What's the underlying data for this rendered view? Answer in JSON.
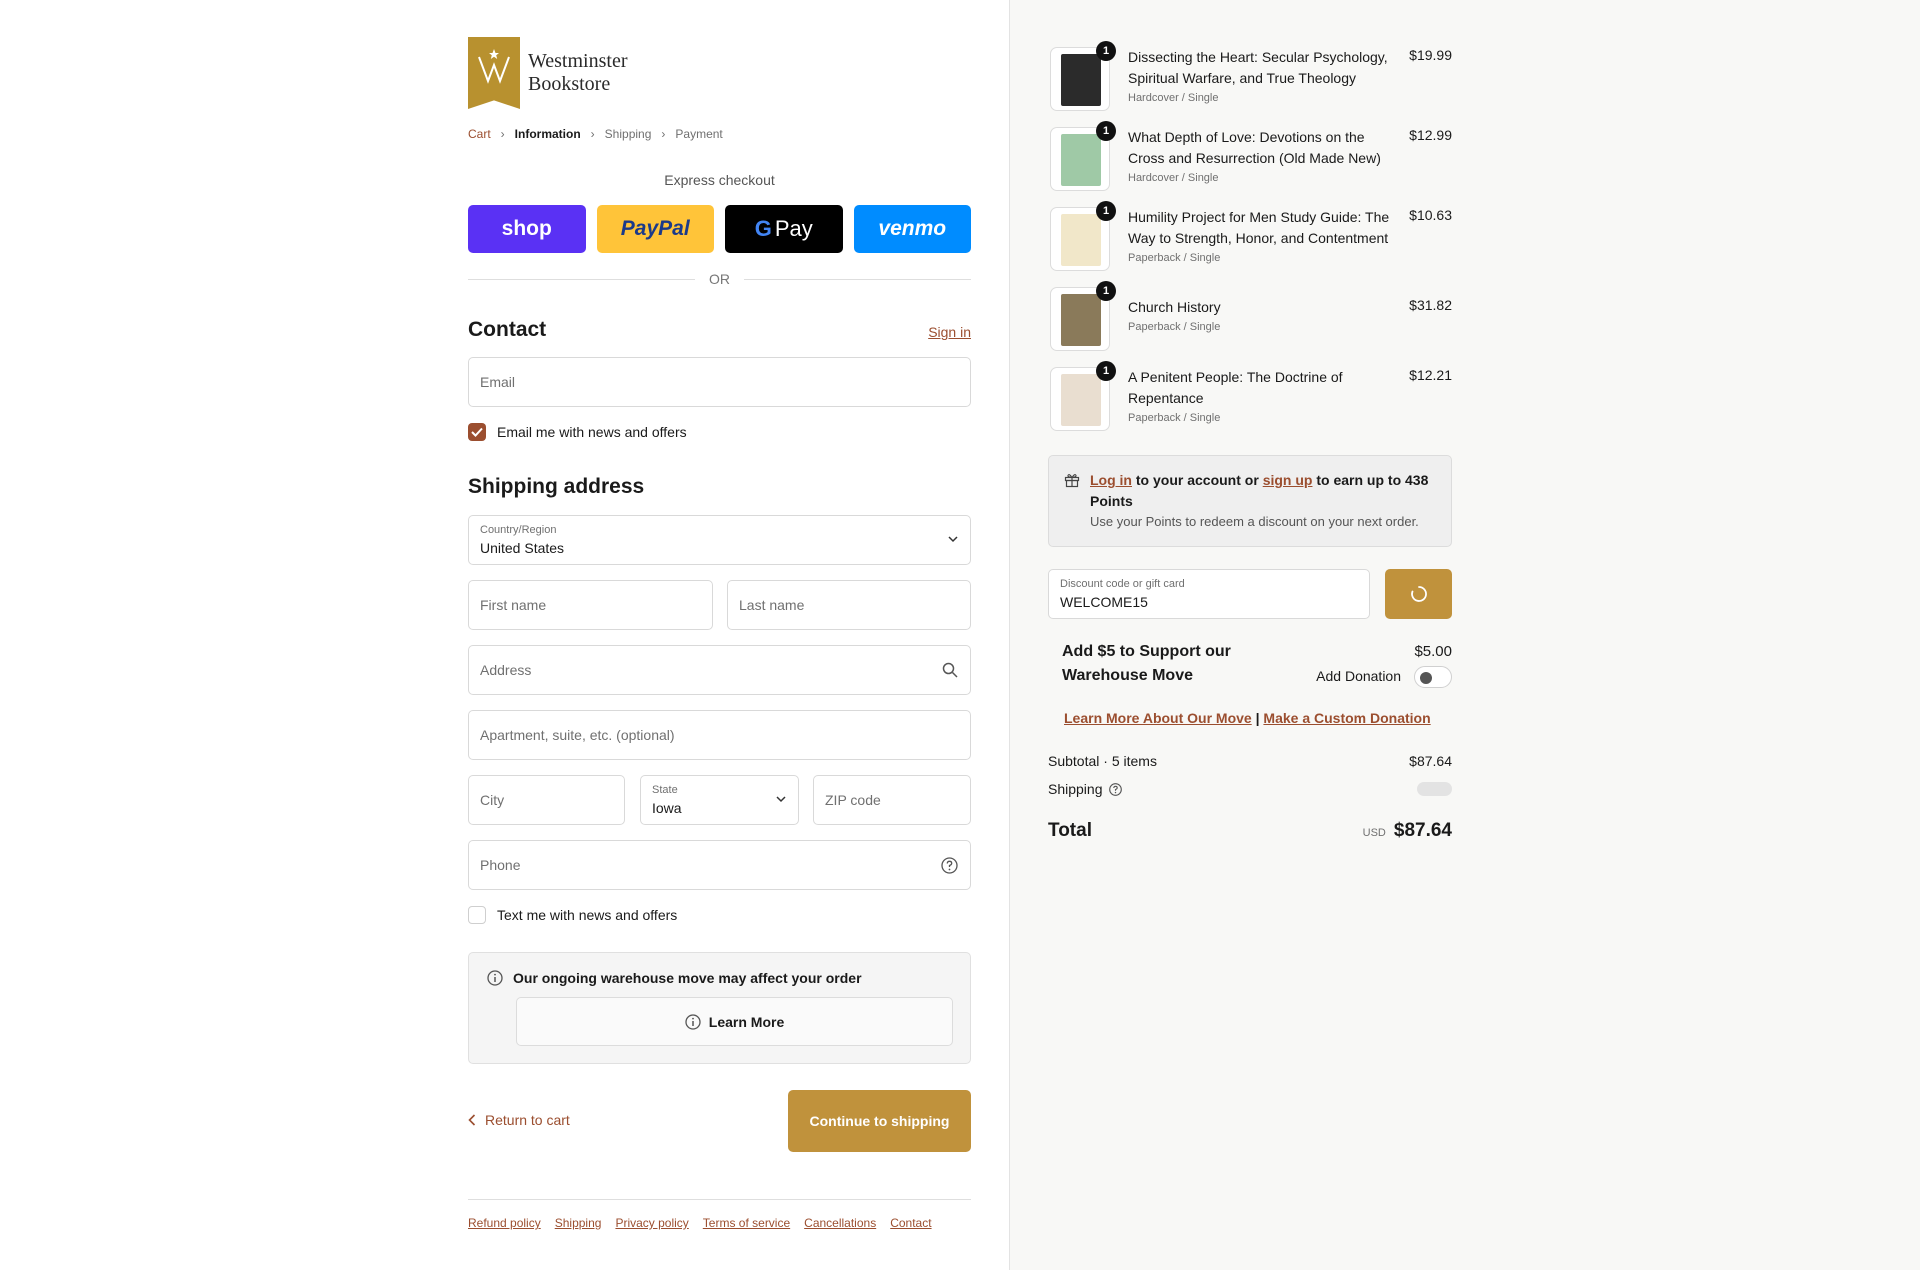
{
  "store": {
    "name_line1": "Westminster",
    "name_line2": "Bookstore",
    "brand_color": "#b8912f",
    "accent_color": "#9b4e2f"
  },
  "breadcrumb": [
    {
      "label": "Cart",
      "state": "link"
    },
    {
      "label": "Information",
      "state": "current"
    },
    {
      "label": "Shipping",
      "state": "upcoming"
    },
    {
      "label": "Payment",
      "state": "upcoming"
    }
  ],
  "express": {
    "title": "Express checkout",
    "shop": "shop",
    "paypal": "PayPal",
    "gpay": "Pay",
    "venmo": "venmo",
    "or": "OR"
  },
  "contact": {
    "heading": "Contact",
    "sign_in": "Sign in",
    "email_placeholder": "Email",
    "email_news": "Email me with news and offers",
    "email_news_checked": true
  },
  "shipping": {
    "heading": "Shipping address",
    "country_label": "Country/Region",
    "country_value": "United States",
    "first_name": "First name",
    "last_name": "Last name",
    "address": "Address",
    "apartment": "Apartment, suite, etc. (optional)",
    "city": "City",
    "state_label": "State",
    "state_value": "Iowa",
    "zip": "ZIP code",
    "phone": "Phone",
    "text_news": "Text me with news and offers",
    "text_news_checked": false
  },
  "notice": {
    "title": "Our ongoing warehouse move may affect your order",
    "button": "Learn More"
  },
  "actions": {
    "return": "Return to cart",
    "continue": "Continue to shipping"
  },
  "footer": [
    "Refund policy",
    "Shipping",
    "Privacy policy",
    "Terms of service",
    "Cancellations",
    "Contact"
  ],
  "items": [
    {
      "title": "Dissecting the Heart: Secular Psychology, Spiritual Warfare, and True Theology",
      "variant": "Hardcover / Single",
      "price": "$19.99",
      "qty": "1",
      "cover_color": "#2b2b2b"
    },
    {
      "title": "What Depth of Love: Devotions on the Cross and Resurrection (Old Made New)",
      "variant": "Hardcover / Single",
      "price": "$12.99",
      "qty": "1",
      "cover_color": "#9fc9a6"
    },
    {
      "title": "Humility Project for Men Study Guide: The Way to Strength, Honor, and Contentment",
      "variant": "Paperback / Single",
      "price": "$10.63",
      "qty": "1",
      "cover_color": "#f1e7c9"
    },
    {
      "title": "Church History",
      "variant": "Paperback / Single",
      "price": "$31.82",
      "qty": "1",
      "cover_color": "#8a7a5a"
    },
    {
      "title": "A Penitent People: The Doctrine of Repentance",
      "variant": "Paperback / Single",
      "price": "$12.21",
      "qty": "1",
      "cover_color": "#e9ded0"
    }
  ],
  "points": {
    "login": "Log in",
    "mid": " to your account or ",
    "signup": "sign up",
    "end": " to earn up to 438 Points",
    "sub": "Use your Points to redeem a discount on your next order."
  },
  "discount": {
    "label": "Discount code or gift card",
    "value": "WELCOME15"
  },
  "donation": {
    "title": "Add $5 to Support our Warehouse Move",
    "price": "$5.00",
    "toggle_label": "Add Donation",
    "enabled": false,
    "link1": "Learn More About Our Move",
    "sep": " | ",
    "link2": "Make a Custom Donation"
  },
  "summary": {
    "subtotal_label": "Subtotal · 5 items",
    "subtotal": "$87.64",
    "shipping_label": "Shipping",
    "total_label": "Total",
    "currency": "USD",
    "total": "$87.64"
  }
}
